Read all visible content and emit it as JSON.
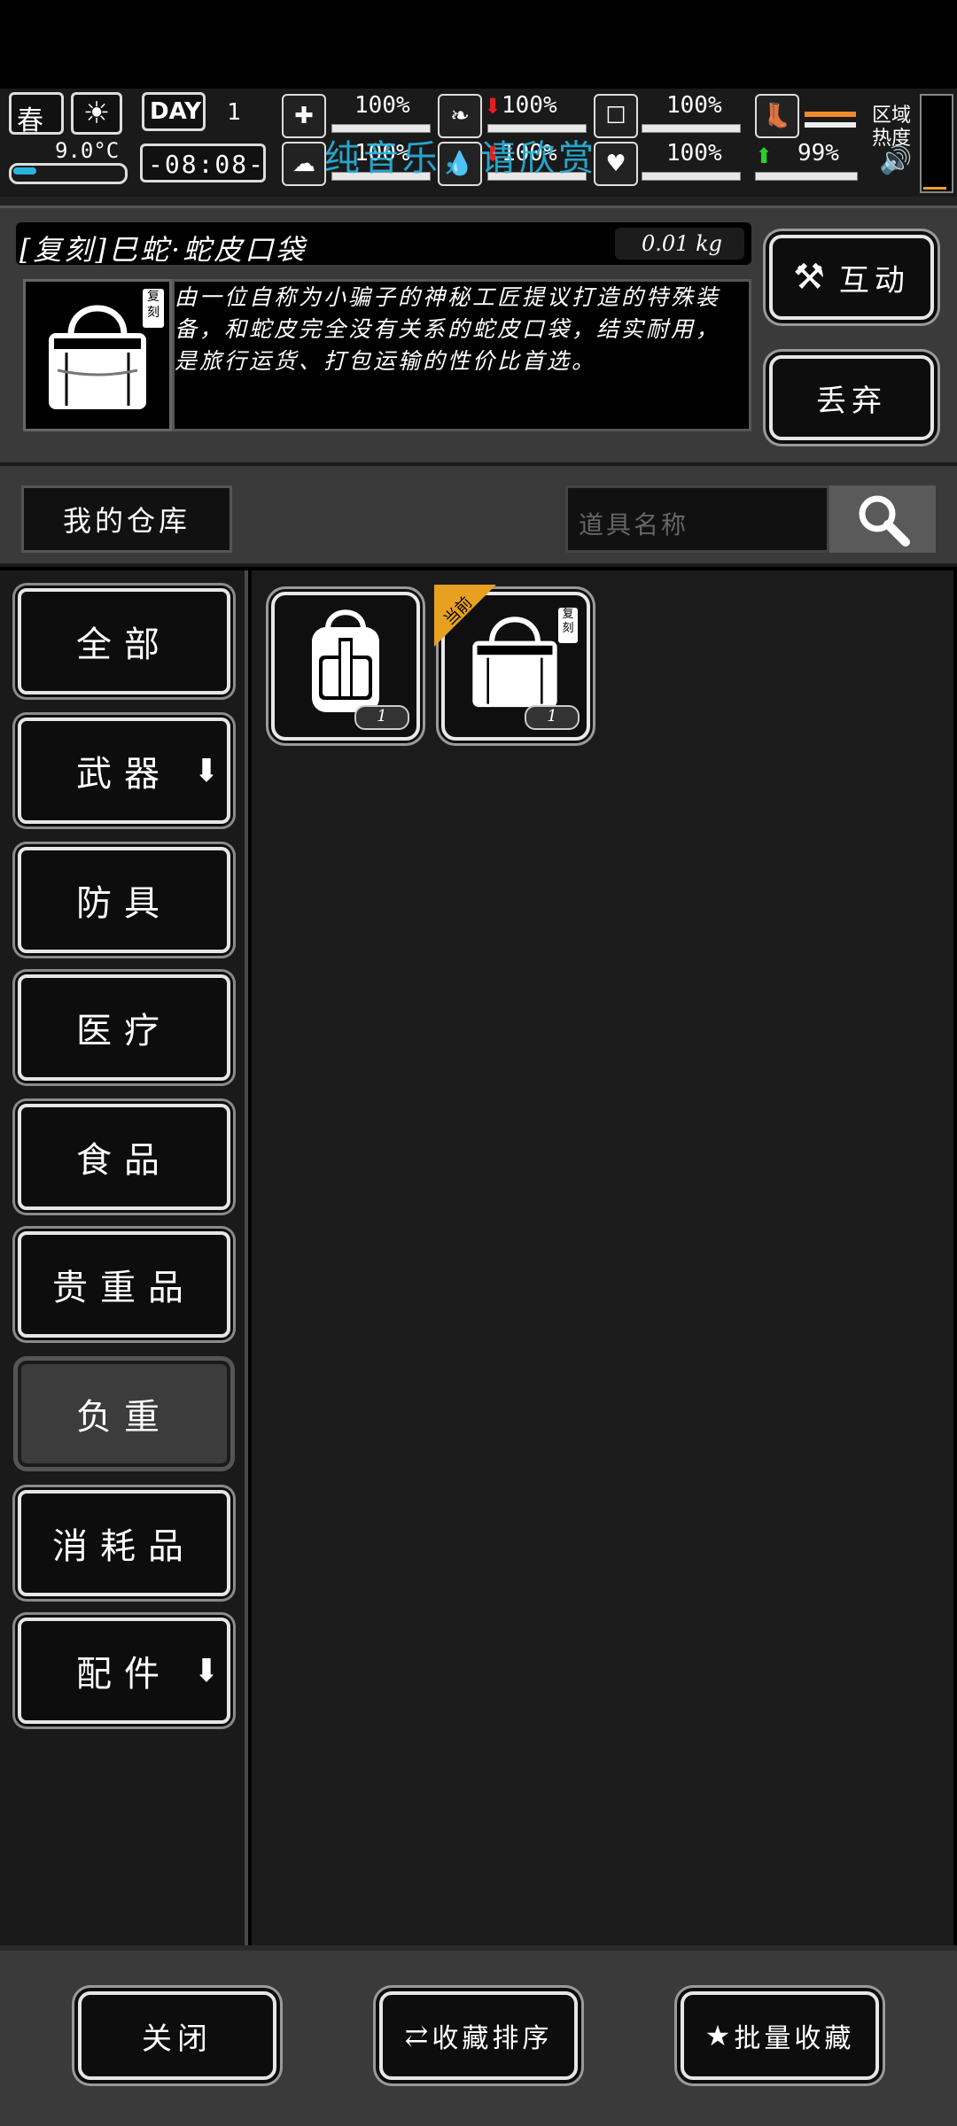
{
  "hud": {
    "season": "春",
    "temperature": "9.0°C",
    "day_label": "DAY",
    "day_number": "1",
    "time": "-08:08-",
    "health_pct": "100%",
    "mood_pct": "100%",
    "hunger_pct": "100%",
    "thirst_pct": "100%",
    "stomach_pct": "100%",
    "water_pct": "100%",
    "stamina_pct": "99%",
    "region_heat_label": "区域热度",
    "watermark": "纯音乐，请欣赏"
  },
  "item": {
    "name": "[复刻]巳蛇·蛇皮口袋",
    "weight": "0.01 kg",
    "badge": "复刻",
    "description": "由一位自称为小骗子的神秘工匠提议打造的特殊装备，和蛇皮完全没有关系的蛇皮口袋，结实耐用，是旅行运货、打包运输的性价比首选。",
    "interact_label": "互动",
    "discard_label": "丢弃"
  },
  "storage": {
    "tab_label": "我的仓库",
    "search_placeholder": "道具名称"
  },
  "categories": [
    {
      "label": "全部"
    },
    {
      "label": "武器"
    },
    {
      "label": "防具"
    },
    {
      "label": "医疗"
    },
    {
      "label": "食品"
    },
    {
      "label": "贵重品"
    },
    {
      "label": "负重"
    },
    {
      "label": "消耗品"
    },
    {
      "label": "配件"
    }
  ],
  "slots": [
    {
      "icon": "backpack-icon",
      "count": "1"
    },
    {
      "icon": "snake-bag-icon",
      "count": "1",
      "ribbon": "当前",
      "badge": "复刻"
    }
  ],
  "footer": {
    "close_label": "关闭",
    "sort_label": "收藏排序",
    "batch_label": "批量收藏"
  }
}
